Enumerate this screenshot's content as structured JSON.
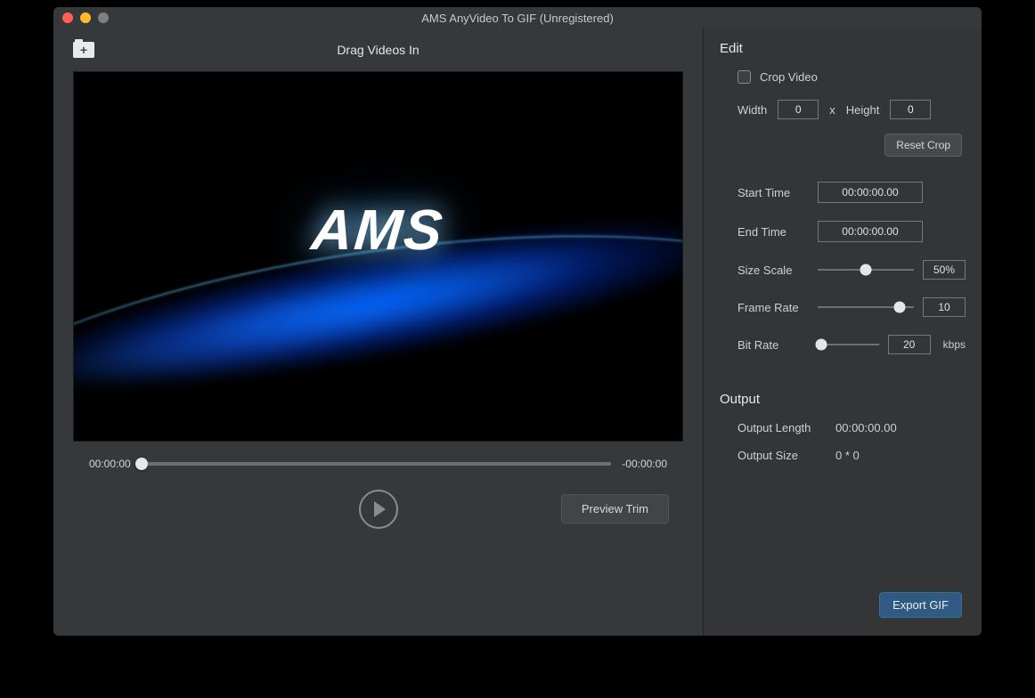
{
  "window": {
    "title": "AMS AnyVideo To GIF (Unregistered)"
  },
  "toolbar": {
    "drag_label": "Drag Videos In"
  },
  "preview": {
    "logo": "AMS"
  },
  "timeline": {
    "current": "00:00:00",
    "remaining": "-00:00:00"
  },
  "controls": {
    "preview_trim": "Preview Trim"
  },
  "edit": {
    "title": "Edit",
    "crop_video_label": "Crop Video",
    "width_label": "Width",
    "width_value": "0",
    "x_label": "x",
    "height_label": "Height",
    "height_value": "0",
    "reset_crop": "Reset Crop",
    "start_time_label": "Start Time",
    "start_time_value": "00:00:00.00",
    "end_time_label": "End Time",
    "end_time_value": "00:00:00.00",
    "size_scale_label": "Size Scale",
    "size_scale_value": "50%",
    "size_scale_pos": 50,
    "frame_rate_label": "Frame Rate",
    "frame_rate_value": "10",
    "frame_rate_pos": 85,
    "bit_rate_label": "Bit Rate",
    "bit_rate_value": "20",
    "bit_rate_unit": "kbps",
    "bit_rate_pos": 6
  },
  "output": {
    "title": "Output",
    "length_label": "Output Length",
    "length_value": "00:00:00.00",
    "size_label": "Output Size",
    "size_value": "0 * 0",
    "export_label": "Export GIF"
  }
}
